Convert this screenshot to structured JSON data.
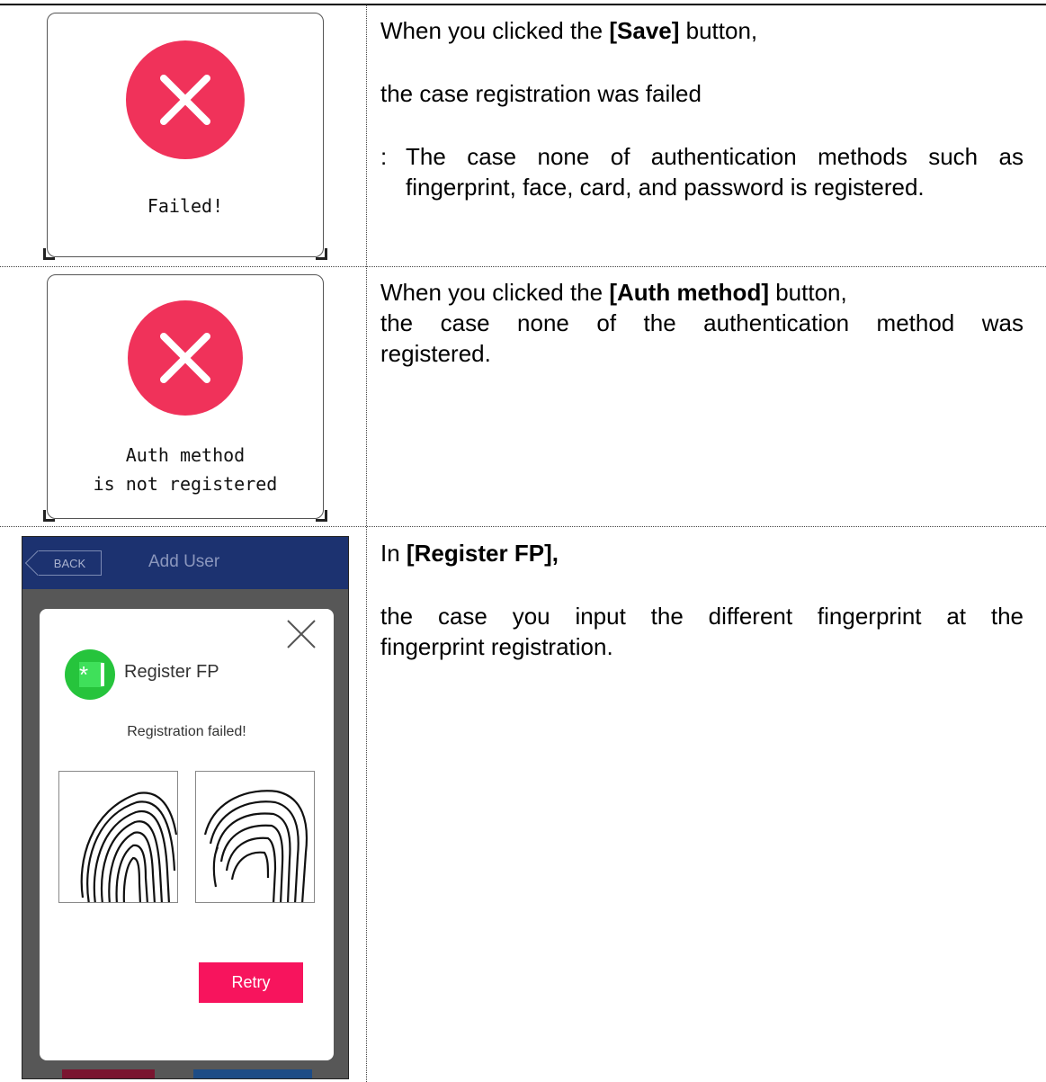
{
  "rows": [
    {
      "dialog": {
        "message_lines": [
          "Failed!"
        ]
      },
      "description": {
        "line1_prefix": "When you clicked the ",
        "line1_bold": "[Save]",
        "line1_suffix": " button,",
        "line2": "the case registration was failed",
        "line3_prefix": ":",
        "line3a": "The case none of authentication methods such as",
        "line3b": "fingerprint, face, card, and password is registered."
      }
    },
    {
      "dialog": {
        "message_lines": [
          "Auth method",
          "is not registered"
        ]
      },
      "description": {
        "line1_prefix": "When you clicked the ",
        "line1_bold": "[Auth method]",
        "line1_suffix": " button,",
        "line2": "the case none of the authentication method was",
        "line3": "registered."
      }
    },
    {
      "device": {
        "back_label": "BACK",
        "title": "Add User",
        "modal_title": "Register FP",
        "status": "Registration failed!",
        "retry_label": "Retry"
      },
      "description": {
        "line1_prefix": "In ",
        "line1_bold": "[Register FP],",
        "line2": "the case you input the different fingerprint at the",
        "line3": "fingerprint registration."
      }
    }
  ],
  "colors": {
    "error": "#f0325a",
    "header": "#1c3270",
    "retry": "#f7145d",
    "badge": "#26c43c"
  },
  "icons": [
    "error-x-icon",
    "close-icon",
    "fingerprint-icon"
  ]
}
